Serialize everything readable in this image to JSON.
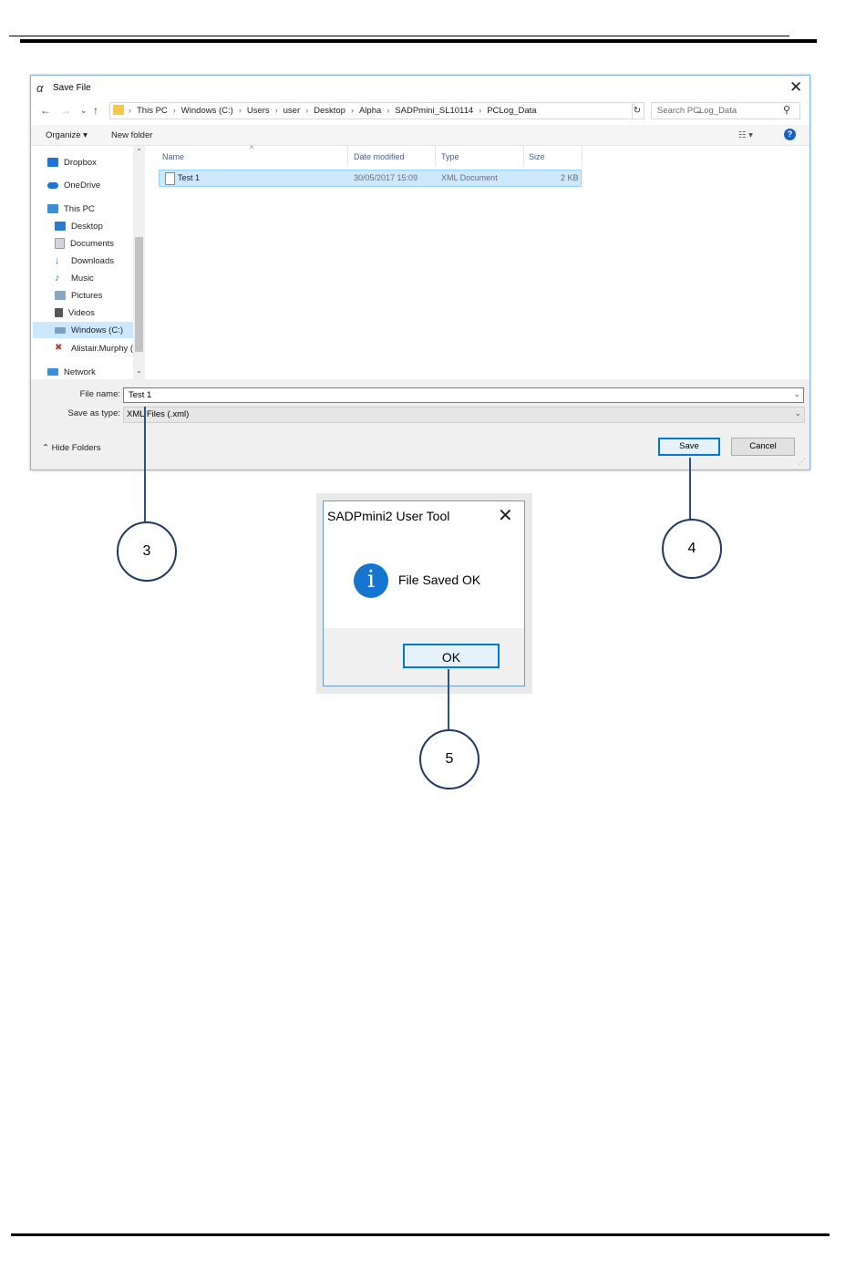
{
  "save_dialog": {
    "title": "Save File",
    "address": {
      "crumbs": [
        "This PC",
        "Windows (C:)",
        "Users",
        "user",
        "Desktop",
        "Alpha",
        "SADPmini_SL10114",
        "PCLog_Data"
      ]
    },
    "search_placeholder": "Search PCLog_Data",
    "toolbar": {
      "organize": "Organize ▾",
      "new_folder": "New folder",
      "help": "?"
    },
    "nav_items": [
      {
        "label": "Dropbox",
        "icon": "dropbox-icon",
        "color": "#1f74d6"
      },
      {
        "label": "OneDrive",
        "icon": "onedrive-icon",
        "color": "#1f74d6"
      },
      {
        "label": "This PC",
        "icon": "computer-icon",
        "color": "#3a8fd9"
      },
      {
        "label": "Desktop",
        "icon": "desktop-icon",
        "color": "#2a7ad1"
      },
      {
        "label": "Documents",
        "icon": "documents-icon",
        "color": "#cfd6de"
      },
      {
        "label": "Downloads",
        "icon": "downloads-icon",
        "color": "#2a7ad1"
      },
      {
        "label": "Music",
        "icon": "music-icon",
        "color": "#2a7ad1"
      },
      {
        "label": "Pictures",
        "icon": "pictures-icon",
        "color": "#8aa4c4"
      },
      {
        "label": "Videos",
        "icon": "videos-icon",
        "color": "#555555"
      },
      {
        "label": "Windows (C:)",
        "icon": "drive-icon",
        "color": "#7aa0c8",
        "selected": true
      },
      {
        "label": "Alistair.Murphy (",
        "icon": "network-drive-icon",
        "color": "#c0392b"
      },
      {
        "label": "Network",
        "icon": "network-icon",
        "color": "#3a8fd9"
      }
    ],
    "columns": {
      "name": "Name",
      "date": "Date modified",
      "type": "Type",
      "size": "Size"
    },
    "files": [
      {
        "name": "Test 1",
        "date": "30/05/2017 15:09",
        "type": "XML Document",
        "size": "2 KB"
      }
    ],
    "file_name_label": "File name:",
    "file_name_value": "Test 1",
    "save_type_label": "Save as type:",
    "save_type_value": "XML Files (.xml)",
    "hide_folders": "Hide Folders",
    "save_button": "Save",
    "cancel_button": "Cancel"
  },
  "message_box": {
    "title": "SADPmini2 User Tool",
    "message": "File Saved OK",
    "ok_button": "OK"
  },
  "callouts": [
    "3",
    "4",
    "5"
  ]
}
